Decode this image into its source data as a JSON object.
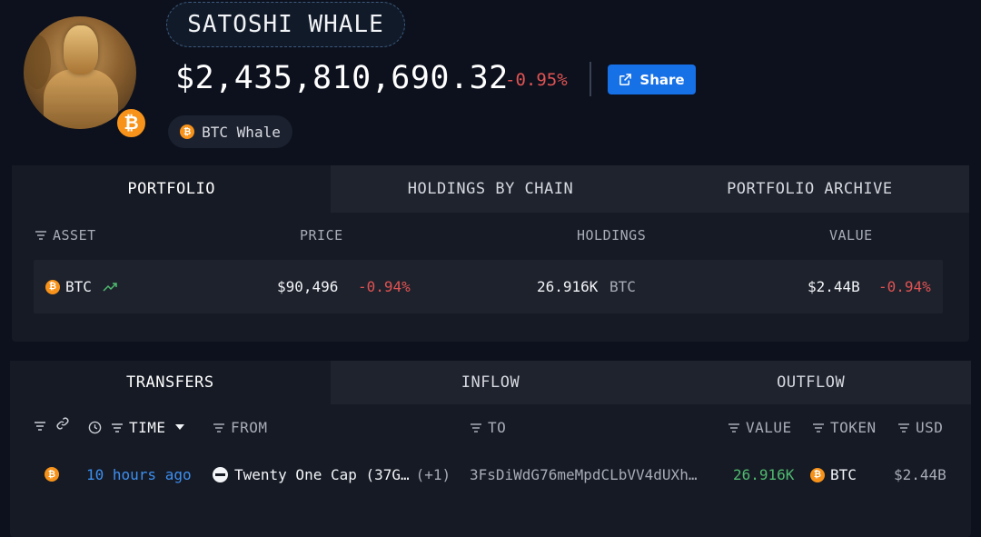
{
  "profile": {
    "name": "SATOSHI WHALE",
    "balance": "$2,435,810,690.32",
    "balance_change": "-0.95%",
    "share_label": "Share",
    "tag_label": "BTC Whale",
    "badge_glyph": "₿"
  },
  "portfolio": {
    "tabs": [
      "PORTFOLIO",
      "HOLDINGS BY CHAIN",
      "PORTFOLIO ARCHIVE"
    ],
    "columns": {
      "asset": "ASSET",
      "price": "PRICE",
      "holdings": "HOLDINGS",
      "value": "VALUE"
    },
    "row": {
      "asset": "BTC",
      "price": "$90,496",
      "price_change": "-0.94%",
      "holdings": "26.916K",
      "holdings_unit": "BTC",
      "value": "$2.44B",
      "value_change": "-0.94%"
    }
  },
  "transfers": {
    "tabs": [
      "TRANSFERS",
      "INFLOW",
      "OUTFLOW"
    ],
    "columns": {
      "time": "TIME",
      "from": "FROM",
      "to": "TO",
      "value": "VALUE",
      "token": "TOKEN",
      "usd": "USD"
    },
    "row": {
      "time": "10 hours ago",
      "from": "Twenty One Cap (37G…",
      "from_extra": "(+1)",
      "to": "3FsDiWdG76meMpdCLbVV4dUXh…",
      "value": "26.916K",
      "token": "BTC",
      "usd": "$2.44B"
    }
  },
  "colors": {
    "accent": "#1670e6",
    "negative": "#e05353",
    "positive": "#4fba6f",
    "btc": "#f7931a"
  },
  "icons": [
    "bitcoin-icon",
    "external-link-icon",
    "filter-icon",
    "link-icon",
    "clock-icon",
    "caret-down-icon",
    "trend-up-icon",
    "entity-icon"
  ]
}
